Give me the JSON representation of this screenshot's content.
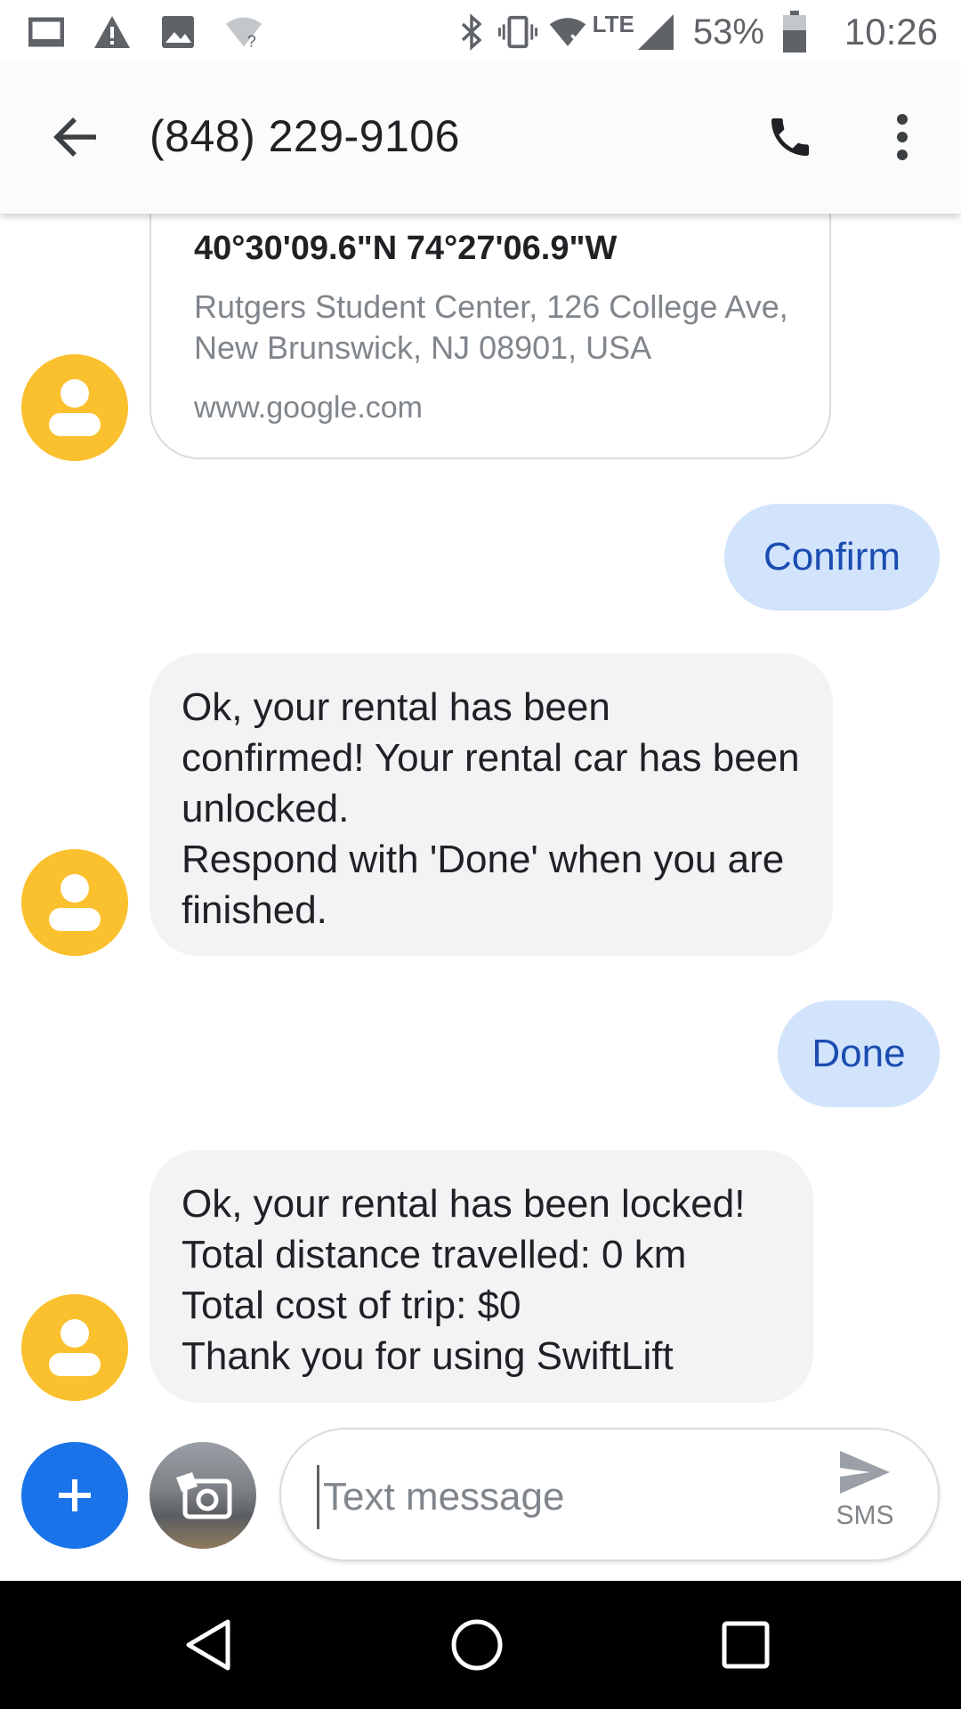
{
  "status_bar": {
    "lte": "LTE",
    "battery_percent": "53%",
    "time": "10:26",
    "icons": [
      "tablet-icon",
      "warning-icon",
      "image-icon",
      "wifi-unknown-icon",
      "bluetooth-icon",
      "vibrate-icon",
      "wifi-off-icon",
      "signal-icon",
      "battery-icon"
    ]
  },
  "app_bar": {
    "title": "(848) 229-9106",
    "icons": [
      "back-arrow-icon",
      "phone-icon",
      "more-vert-icon"
    ]
  },
  "messages": {
    "location_card": {
      "coords": "40°30'09.6\"N 74°27'06.9\"W",
      "address": "Rutgers Student Center, 126 College Ave, New Brunswick, NJ 08901, USA",
      "domain": "www.google.com"
    },
    "out_confirm": "Confirm",
    "in_unlocked": "Ok, your rental has been confirmed! Your rental car has been unlocked.\nRespond with 'Done' when you are finished.",
    "out_done": "Done",
    "in_locked": "Ok, your rental has been locked!\nTotal distance travelled: 0 km\nTotal cost of trip: $0\nThank you for using SwiftLift"
  },
  "compose": {
    "placeholder": "Text message",
    "send_label": "SMS"
  },
  "colors": {
    "avatar": "#fbc02d",
    "outgoing_bubble": "#d2e3fc",
    "outgoing_text": "#1a4db0",
    "incoming_bubble": "#f1f3f4",
    "fab": "#1a73e8"
  }
}
